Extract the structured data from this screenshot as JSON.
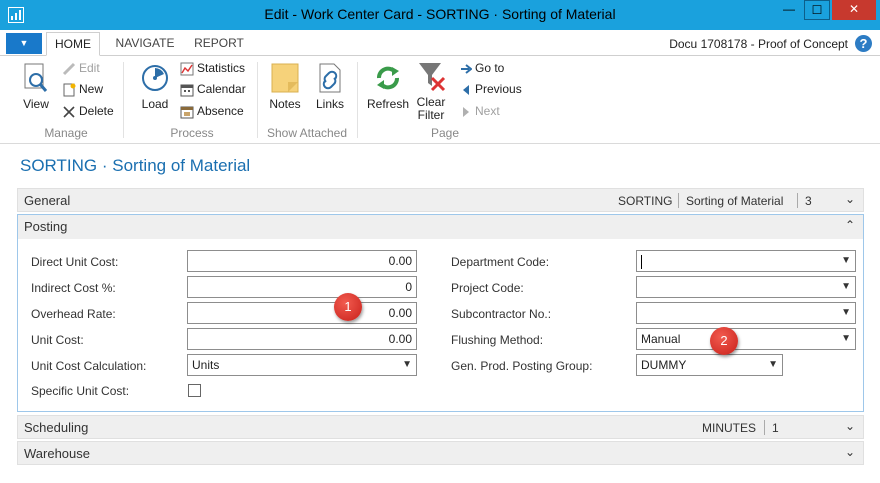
{
  "window": {
    "title": "Edit - Work Center Card - SORTING · Sorting of Material",
    "minimize": "—",
    "maximize": "☐",
    "close": "✕"
  },
  "tabs": {
    "file": "▼",
    "items": [
      "HOME",
      "NAVIGATE",
      "REPORT"
    ],
    "active": "HOME"
  },
  "company": "Docu 1708178 - Proof of Concept",
  "help": "?",
  "ribbon": {
    "manage": {
      "label": "Manage",
      "view": "View",
      "edit": "Edit",
      "new": "New",
      "delete": "Delete"
    },
    "process": {
      "label": "Process",
      "load": "Load",
      "statistics": "Statistics",
      "calendar": "Calendar",
      "absence": "Absence"
    },
    "show_attached": {
      "label": "Show Attached",
      "notes": "Notes",
      "links": "Links"
    },
    "page": {
      "label": "Page",
      "refresh": "Refresh",
      "clear_filter_1": "Clear",
      "clear_filter_2": "Filter",
      "go_to": "Go to",
      "previous": "Previous",
      "next": "Next"
    }
  },
  "page_title": "SORTING · Sorting of Material",
  "general": {
    "title": "General",
    "summary": [
      "SORTING",
      "Sorting of Material",
      "3"
    ],
    "chevron": "⌄"
  },
  "posting": {
    "title": "Posting",
    "chevron": "⌃",
    "left": [
      {
        "label": "Direct Unit Cost:",
        "value": "0.00"
      },
      {
        "label": "Indirect Cost %:",
        "value": "0"
      },
      {
        "label": "Overhead Rate:",
        "value": "0.00"
      },
      {
        "label": "Unit Cost:",
        "value": "0.00"
      },
      {
        "label": "Unit Cost Calculation:",
        "value": "Units"
      },
      {
        "label": "Specific Unit Cost:",
        "value": false
      }
    ],
    "right": [
      {
        "label": "Department Code:",
        "value": ""
      },
      {
        "label": "Project Code:",
        "value": ""
      },
      {
        "label": "Subcontractor No.:",
        "value": ""
      },
      {
        "label": "Flushing Method:",
        "value": "Manual"
      },
      {
        "label": "Gen. Prod. Posting Group:",
        "value": "DUMMY"
      }
    ]
  },
  "scheduling": {
    "title": "Scheduling",
    "summary": [
      "MINUTES",
      "1"
    ],
    "chevron": "⌄"
  },
  "warehouse": {
    "title": "Warehouse",
    "chevron": "⌄"
  },
  "callouts": [
    "1",
    "2"
  ],
  "colors": {
    "titlebar": "#1aa1dd",
    "accent": "#1a6fb0",
    "callout": "#d8302a"
  }
}
